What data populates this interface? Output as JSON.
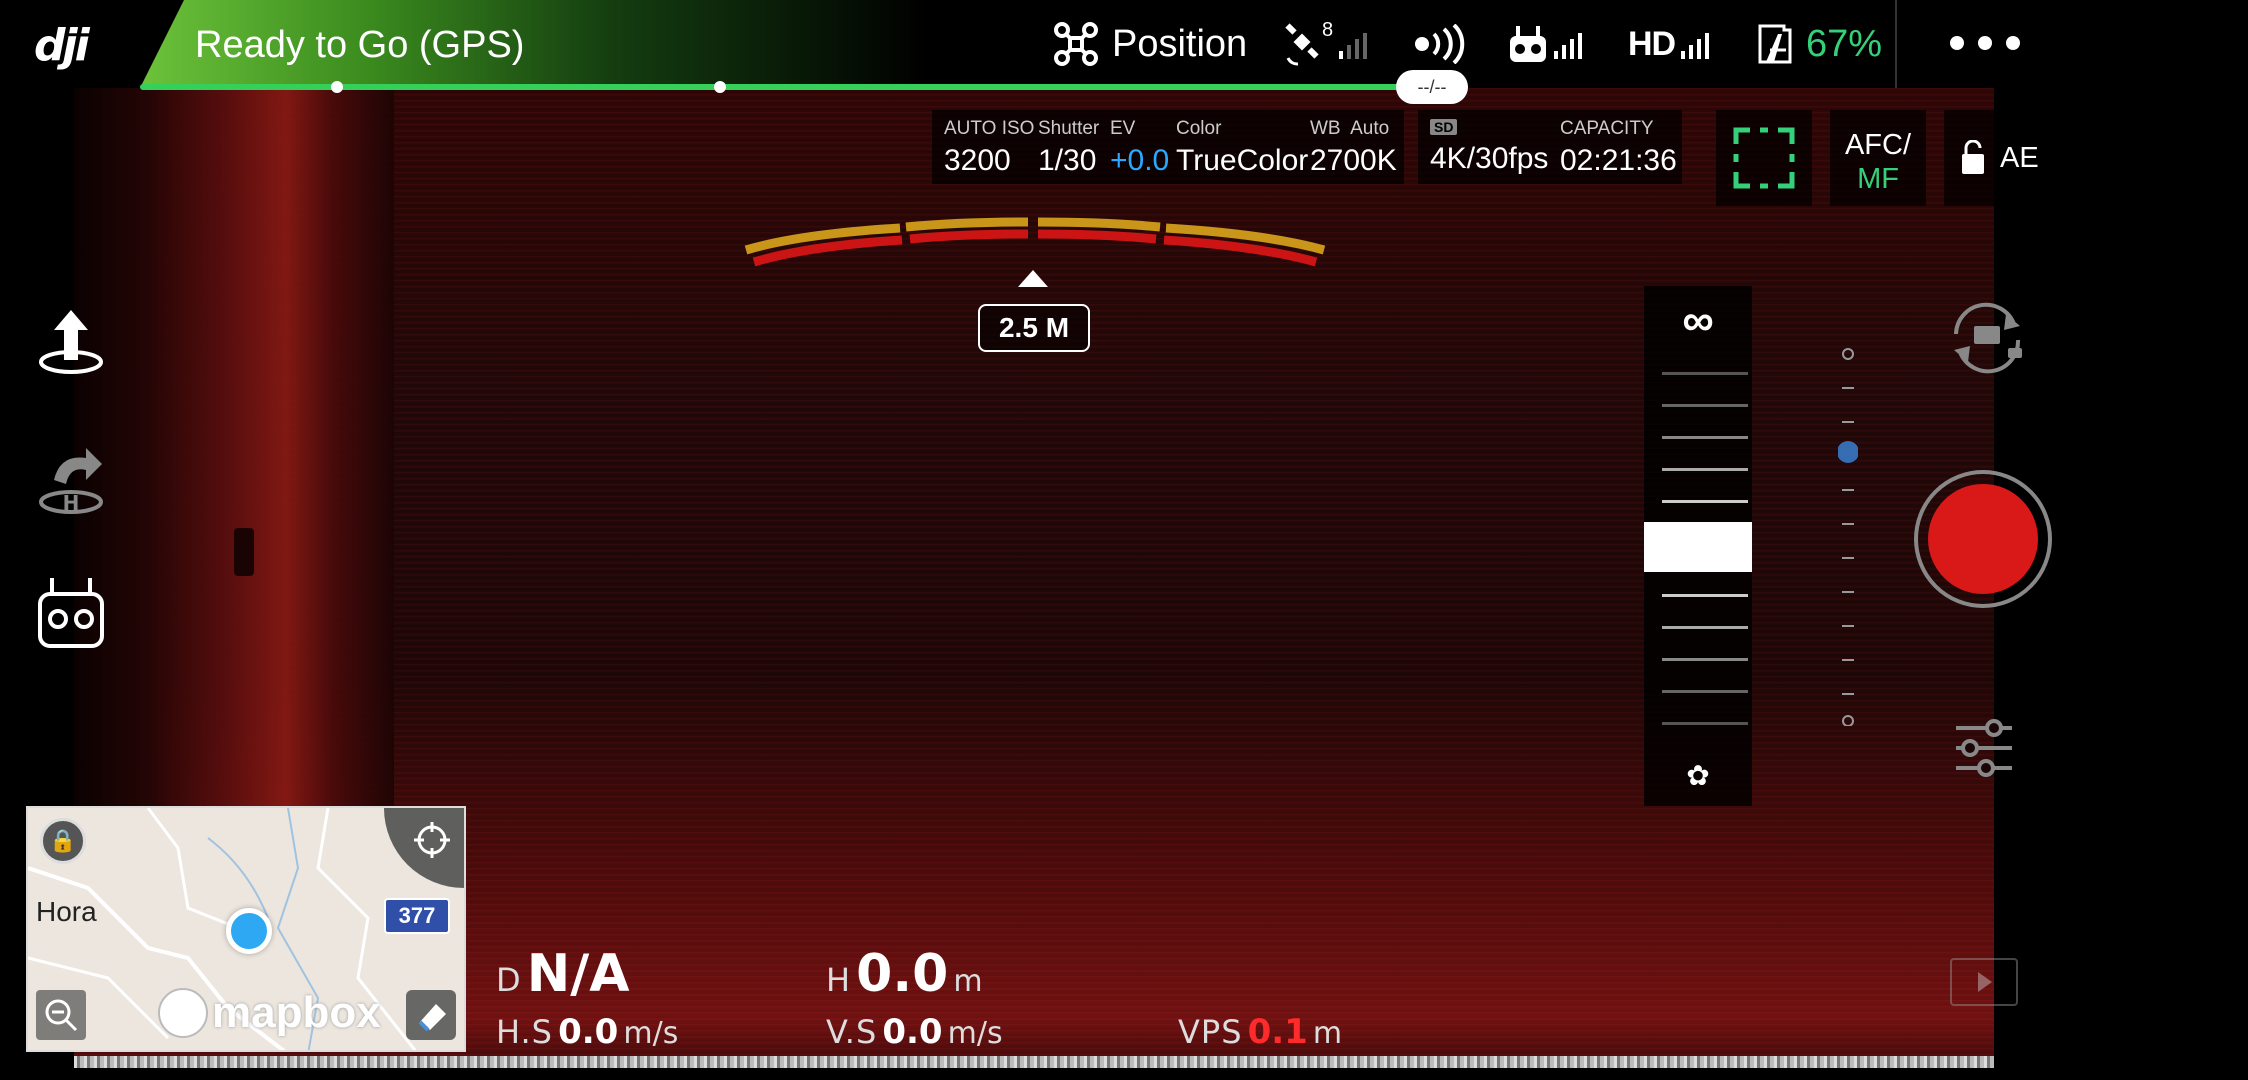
{
  "header": {
    "logo": "dji",
    "status": "Ready to Go (GPS)",
    "eta": "--/--",
    "flight_mode": "Position",
    "gps_sat_count": "8",
    "hd": "HD",
    "battery": "67%"
  },
  "camera": {
    "iso_label": "AUTO ISO",
    "iso": "3200",
    "shutter_label": "Shutter",
    "shutter": "1/30",
    "ev_label": "EV",
    "ev": "+0.0",
    "color_label": "Color",
    "color": "TrueColor",
    "wb_label": "WB  Auto",
    "wb": "2700K",
    "sd_badge": "SD",
    "resolution": "4K/30fps",
    "capacity_label": "CAPACITY",
    "capacity": "02:21:36",
    "afc": "AFC/",
    "mf": "MF",
    "ae": "AE"
  },
  "obstacle": {
    "distance": "2.5 M"
  },
  "focus": {
    "infinity": "∞",
    "macro": "✿"
  },
  "telemetry": {
    "d_label": "D",
    "d_value": "N/A",
    "h_label": "H",
    "h_value": "0.0",
    "h_unit": "m",
    "hs_label": "H.S",
    "hs_value": "0.0",
    "hs_unit": "m/s",
    "vs_label": "V.S",
    "vs_value": "0.0",
    "vs_unit": "m/s",
    "vps_label": "VPS",
    "vps_value": "0.1",
    "vps_unit": "m"
  },
  "map": {
    "town": "Hora",
    "road_badge": "377",
    "brand": "mapbox"
  },
  "colors": {
    "accent_green": "#35d07a",
    "ev_blue": "#2aa8ff",
    "warning_red": "#ff2a2a",
    "record_red": "#d91818"
  },
  "icons": {
    "takeoff": "takeoff-icon",
    "return_home": "return-home-icon",
    "remote": "remote-controller-icon",
    "camera_switch": "camera-switch-icon",
    "settings": "camera-settings-icon",
    "playback": "playback-icon"
  }
}
